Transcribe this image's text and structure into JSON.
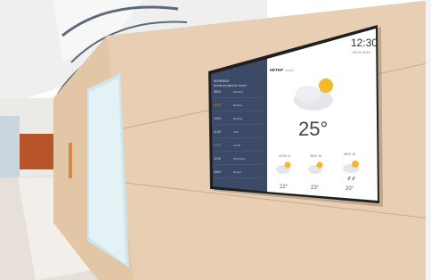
{
  "scene": {
    "description_colors": {
      "wall": "#e7cdb0",
      "ceiling": "#ececec",
      "floor": "#e9e3dc",
      "screen_sidebar": "#3b4a66",
      "screen_main": "#ffffff",
      "sun": "#f2b92a",
      "accent_orange": "#e08a2a",
      "rain": "#4a90d9"
    }
  },
  "screen": {
    "time": "12:30",
    "date": "29.02.2015",
    "location": "HETEP",
    "location_sub": "cloudy",
    "temperature": "25°",
    "forecast": [
      {
        "day": "MON 14",
        "temp": "22°"
      },
      {
        "day": "WED 16",
        "temp": "23°"
      },
      {
        "day": "WED 18",
        "temp": "20°"
      }
    ],
    "sidebar": {
      "header_1": "SCHEDULE",
      "header_2": "ROOM SCHEDULE TODAY",
      "rows": [
        {
          "time": "08:00",
          "text": "Meeting"
        },
        {
          "time": "09:30",
          "text": "Review"
        },
        {
          "time": "10:00",
          "text": "Briefing"
        },
        {
          "time": "11:30",
          "text": "Call"
        },
        {
          "time": "13:00",
          "text": "Lunch"
        },
        {
          "time": "14:30",
          "text": "Workshop"
        },
        {
          "time": "16:00",
          "text": "Report"
        }
      ]
    }
  }
}
